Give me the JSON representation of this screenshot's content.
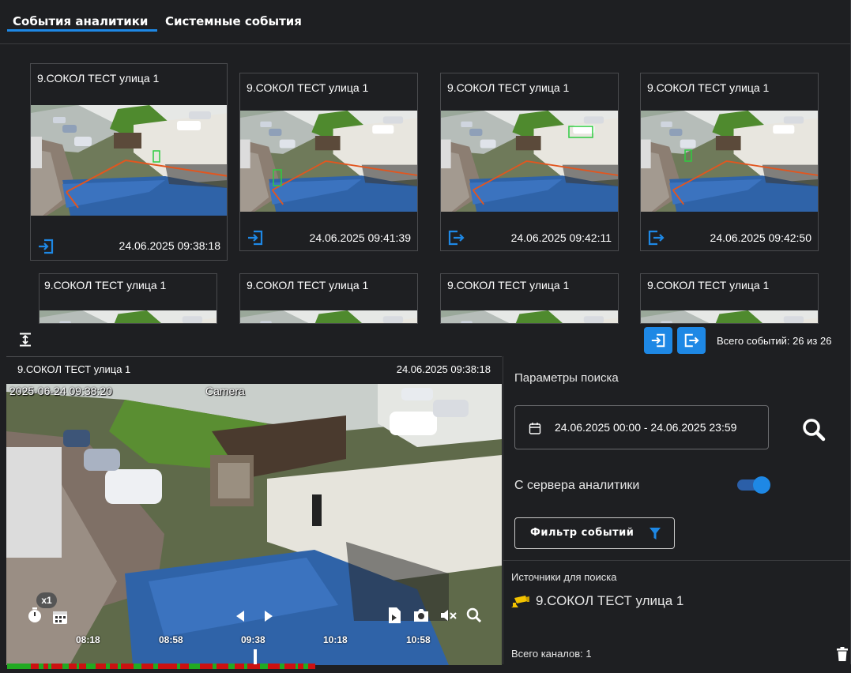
{
  "tabs": [
    {
      "label": "События аналитики",
      "active": true
    },
    {
      "label": "Системные события",
      "active": false
    }
  ],
  "events": [
    {
      "title": "9.СОКОЛ ТЕСТ улица 1",
      "date": "24.06.2025 09:38:18",
      "event_icon": "enter-icon"
    },
    {
      "title": "9.СОКОЛ ТЕСТ улица 1",
      "date": "24.06.2025 09:41:39",
      "event_icon": "enter-icon"
    },
    {
      "title": "9.СОКОЛ ТЕСТ улица 1",
      "date": "24.06.2025 09:42:11",
      "event_icon": "exit-icon"
    },
    {
      "title": "9.СОКОЛ ТЕСТ улица 1",
      "date": "24.06.2025 09:42:50",
      "event_icon": "exit-icon"
    },
    {
      "title": "9.СОКОЛ ТЕСТ улица 1"
    },
    {
      "title": "9.СОКОЛ ТЕСТ улица 1"
    },
    {
      "title": "9.СОКОЛ ТЕСТ улица 1"
    },
    {
      "title": "9.СОКОЛ ТЕСТ улица 1"
    }
  ],
  "events_total": "Всего событий: 26 из 26",
  "player": {
    "title": "9.СОКОЛ ТЕСТ улица 1",
    "date": "24.06.2025 09:38:18",
    "osd_time": "2025-06-24 09:38:20",
    "osd_camera": "Camera",
    "speed": "x1",
    "timeline": [
      "08:18",
      "08:58",
      "09:38",
      "10:18",
      "10:58"
    ]
  },
  "search": {
    "title": "Параметры поиска",
    "date_range": "24.06.2025 00:00 - 24.06.2025 23:59",
    "server_label": "С сервера аналитики",
    "server_enabled": true,
    "filter_label": "Фильтр событий",
    "sources_title": "Источники для поиска",
    "source": "9.СОКОЛ ТЕСТ улица 1",
    "channels": "Всего каналов: 1"
  },
  "colors": {
    "accent": "#1e88e5",
    "background": "#1e1f22",
    "timeline_red": "#cc1111",
    "timeline_green": "#22aa22"
  }
}
